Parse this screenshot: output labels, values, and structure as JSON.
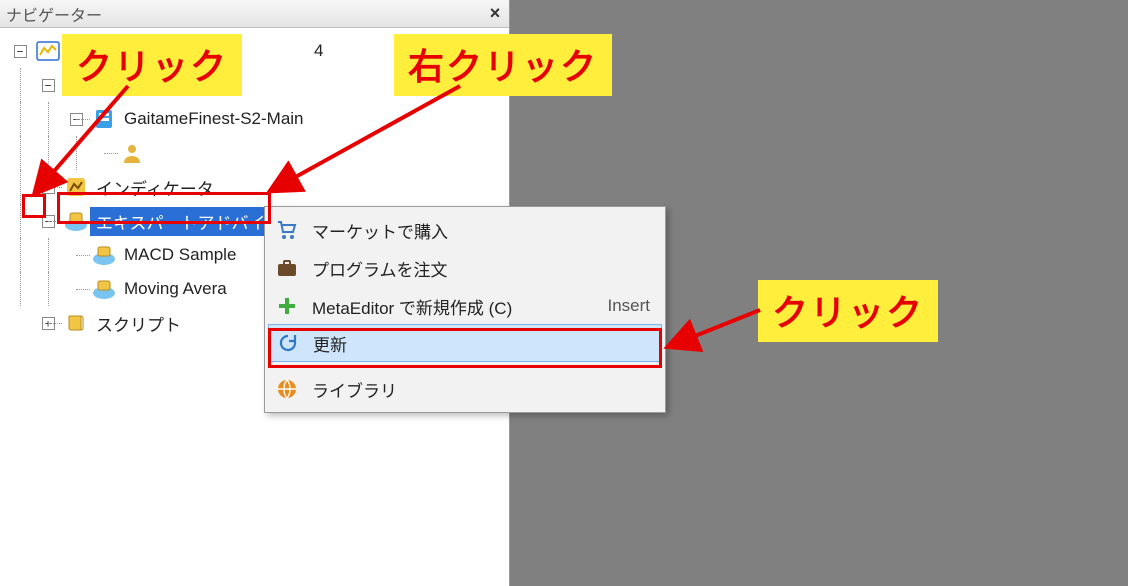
{
  "panel": {
    "title": "ナビゲーター",
    "close_glyph": "×"
  },
  "tree": {
    "root_suffix": "4",
    "account_server": "GaitameFinest-S2-Main",
    "indicator_label": "インディケータ",
    "ea_label": "エキスパートアドバイザ",
    "ea_children": [
      "MACD Sample",
      "Moving Avera"
    ],
    "script_label": "スクリプト"
  },
  "menu": {
    "items": [
      {
        "icon": "cart",
        "label": "マーケットで購入",
        "accel": ""
      },
      {
        "icon": "briefcase",
        "label": "プログラムを注文",
        "accel": ""
      },
      {
        "icon": "plus",
        "label": "MetaEditor で新規作成 (C)",
        "accel": "Insert"
      },
      {
        "icon": "refresh",
        "label": "更新",
        "accel": "",
        "hover": true
      },
      {
        "sep": true
      },
      {
        "icon": "globe",
        "label": "ライブラリ",
        "accel": ""
      }
    ]
  },
  "callouts": {
    "click": "クリック",
    "right_click": "右クリック",
    "click2": "クリック"
  }
}
